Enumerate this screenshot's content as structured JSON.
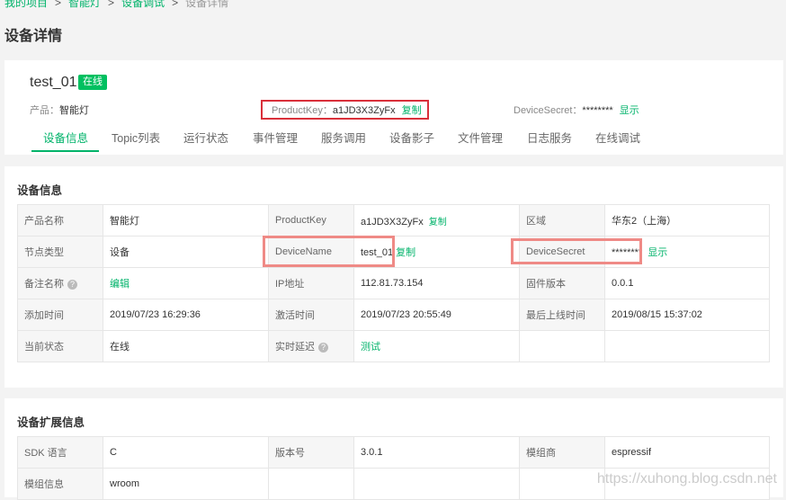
{
  "breadcrumb": [
    "我的项目",
    "智能灯",
    "设备调试",
    "设备详情"
  ],
  "page_title": "设备详情",
  "device": {
    "name": "test_01",
    "status_badge": "在线",
    "product_label": "产品：",
    "product_value": "智能灯",
    "productkey_label": "ProductKey：",
    "productkey_value": "a1JD3X3ZyFx",
    "copy_label": "复制",
    "devicesecret_label": "DeviceSecret：",
    "devicesecret_value": "********",
    "show_label": "显示"
  },
  "tabs": [
    "设备信息",
    "Topic列表",
    "运行状态",
    "事件管理",
    "服务调用",
    "设备影子",
    "文件管理",
    "日志服务",
    "在线调试"
  ],
  "info": {
    "title": "设备信息",
    "rows": [
      [
        [
          "产品名称",
          "智能灯"
        ],
        [
          "ProductKey",
          "a1JD3X3ZyFx"
        ],
        [
          "区域",
          "华东2（上海）"
        ]
      ],
      [
        [
          "节点类型",
          "设备"
        ],
        [
          "DeviceName",
          "test_01"
        ],
        [
          "DeviceSecret",
          "********"
        ]
      ],
      [
        [
          "备注名称",
          "编辑"
        ],
        [
          "IP地址",
          "112.81.73.154"
        ],
        [
          "固件版本",
          "0.0.1"
        ]
      ],
      [
        [
          "添加时间",
          "2019/07/23 16:29:36"
        ],
        [
          "激活时间",
          "2019/07/23 20:55:49"
        ],
        [
          "最后上线时间",
          "2019/08/15 15:37:02"
        ]
      ],
      [
        [
          "当前状态",
          "在线"
        ],
        [
          "实时延迟",
          "测试"
        ],
        [
          "",
          ""
        ]
      ]
    ],
    "copy_label": "复制",
    "show_label": "显示"
  },
  "ext": {
    "title": "设备扩展信息",
    "rows": [
      [
        [
          "SDK 语言",
          "C"
        ],
        [
          "版本号",
          "3.0.1"
        ],
        [
          "模组商",
          "espressif"
        ]
      ],
      [
        [
          "模组信息",
          "wroom"
        ],
        [
          "",
          ""
        ],
        [
          "",
          ""
        ]
      ]
    ]
  },
  "watermark": "https://xuhong.blog.csdn.net",
  "colors": {
    "accent": "#00b36a",
    "badge": "#00c060",
    "highlight_red": "#d9303a",
    "highlight_pink": "#ef8a86"
  }
}
